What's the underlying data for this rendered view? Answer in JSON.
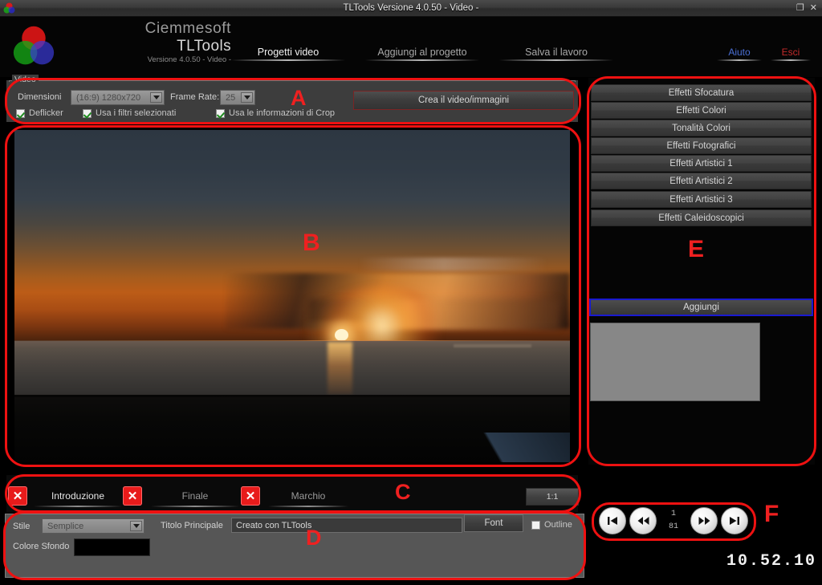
{
  "window": {
    "title": "TLTools Versione 4.0.50 - Video -",
    "restore_icon": "restore-icon",
    "close_icon": "close-icon",
    "restore_glyph": "❐",
    "close_glyph": "✕"
  },
  "header": {
    "brand_line1": "Ciemmesoft",
    "brand_line2": "TLTools",
    "brand_line3": "Versione 4.0.50 - Video -",
    "nav": [
      {
        "label": "Progetti video",
        "active": true
      },
      {
        "label": "Aggiungi al progetto",
        "active": false
      },
      {
        "label": "Salva il lavoro",
        "active": false
      }
    ],
    "help_label": "Aiuto",
    "exit_label": "Esci",
    "help_color": "#4a6fd4",
    "exit_color": "#c32a2a"
  },
  "zones": {
    "a": "A",
    "b": "B",
    "c": "C",
    "d": "D",
    "e": "E",
    "f": "F",
    "outline_color": "#ee1111"
  },
  "video_panel": {
    "group_label": "Video",
    "dimensions_label": "Dimensioni",
    "dimensions_value": "(16:9) 1280x720",
    "frame_rate_label": "Frame Rate:",
    "frame_rate_value": "25",
    "checkboxes": [
      {
        "label": "Deflicker",
        "checked": true
      },
      {
        "label": "Usa i filtri selezionati",
        "checked": true
      },
      {
        "label": "Usa le informazioni di Crop",
        "checked": true
      }
    ],
    "create_button": "Crea il video/immagini"
  },
  "timeline": {
    "tabs": [
      {
        "label": "Introduzione",
        "active": true
      },
      {
        "label": "Finale",
        "active": false
      },
      {
        "label": "Marchio",
        "active": false
      }
    ],
    "delete_glyph": "✕",
    "ratio_button": "1:1"
  },
  "title_panel": {
    "style_label": "Stile",
    "style_value": "Semplice",
    "main_title_label": "Titolo Principale",
    "main_title_value": "Creato con TLTools",
    "bg_color_label": "Colore Sfondo",
    "bg_color_value": "#000000",
    "font_button": "Font",
    "outline_label": "Outline",
    "outline_checked": false
  },
  "effects_panel": {
    "buttons": [
      "Effetti Sfocatura",
      "Effetti Colori",
      "Tonalità Colori",
      "Effetti Fotografici",
      "Effetti Artistici 1",
      "Effetti Artistici 2",
      "Effetti Artistici 3",
      "Effetti Caleidoscopici"
    ],
    "add_button": "Aggiungi",
    "add_button_border": "#1a1ad0"
  },
  "playback": {
    "first_glyph": "⏮",
    "rewind_glyph": "⏪",
    "forward_glyph": "⏩",
    "last_glyph": "⏭",
    "current_frame": "1",
    "total_frames": "81",
    "timecode": "10.52.10"
  }
}
